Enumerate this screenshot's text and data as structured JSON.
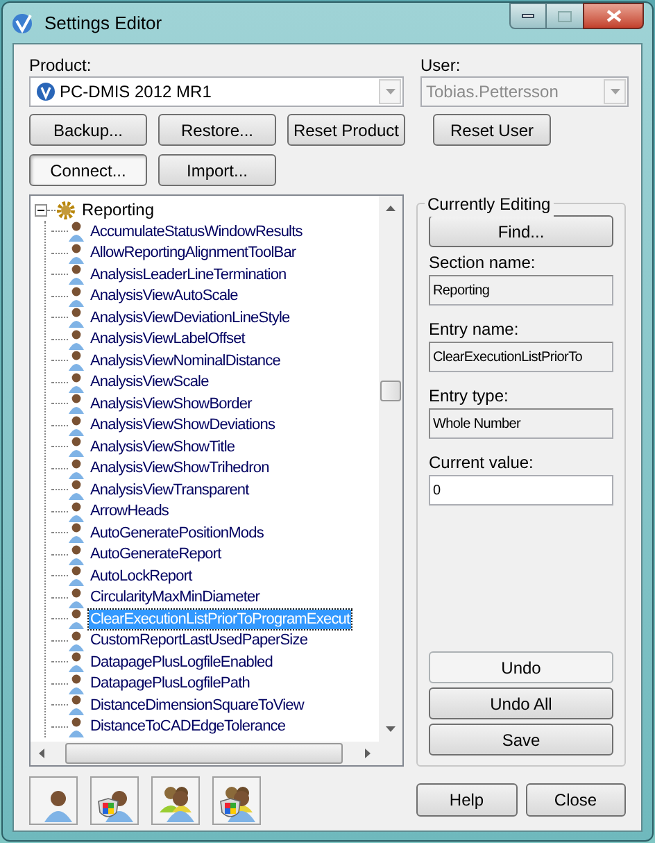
{
  "window": {
    "title": "Settings Editor"
  },
  "product": {
    "label": "Product:",
    "value": "PC-DMIS 2012 MR1",
    "disabled": false
  },
  "user": {
    "label": "User:",
    "value": "Tobias.Pettersson",
    "disabled": true
  },
  "buttons": [
    {
      "label": "Backup...",
      "pressed": false
    },
    {
      "label": "Restore...",
      "pressed": false
    },
    {
      "label": "Reset Product",
      "pressed": false
    },
    {
      "label": "Reset User",
      "pressed": false
    },
    {
      "label": "Connect...",
      "pressed": true
    },
    {
      "label": "Import...",
      "pressed": false
    }
  ],
  "tree": {
    "label": "Reporting",
    "expanded": true,
    "children": [
      {
        "label": "AccumulateStatusWindowResults",
        "selected": false
      },
      {
        "label": "AllowReportingAlignmentToolBar",
        "selected": false
      },
      {
        "label": "AnalysisLeaderLineTermination",
        "selected": false
      },
      {
        "label": "AnalysisViewAutoScale",
        "selected": false
      },
      {
        "label": "AnalysisViewDeviationLineStyle",
        "selected": false
      },
      {
        "label": "AnalysisViewLabelOffset",
        "selected": false
      },
      {
        "label": "AnalysisViewNominalDistance",
        "selected": false
      },
      {
        "label": "AnalysisViewScale",
        "selected": false
      },
      {
        "label": "AnalysisViewShowBorder",
        "selected": false
      },
      {
        "label": "AnalysisViewShowDeviations",
        "selected": false
      },
      {
        "label": "AnalysisViewShowTitle",
        "selected": false
      },
      {
        "label": "AnalysisViewShowTrihedron",
        "selected": false
      },
      {
        "label": "AnalysisViewTransparent",
        "selected": false
      },
      {
        "label": "ArrowHeads",
        "selected": false
      },
      {
        "label": "AutoGeneratePositionMods",
        "selected": false
      },
      {
        "label": "AutoGenerateReport",
        "selected": false
      },
      {
        "label": "AutoLockReport",
        "selected": false
      },
      {
        "label": "CircularityMaxMinDiameter",
        "selected": false
      },
      {
        "label": "ClearExecutionListPriorToProgramExecut",
        "selected": true
      },
      {
        "label": "CustomReportLastUsedPaperSize",
        "selected": false
      },
      {
        "label": "DatapagePlusLogfileEnabled",
        "selected": false
      },
      {
        "label": "DatapagePlusLogfilePath",
        "selected": false
      },
      {
        "label": "DistanceDimensionSquareToView",
        "selected": false
      },
      {
        "label": "DistanceToCADEdgeTolerance",
        "selected": false
      }
    ]
  },
  "user_buttons": [
    {
      "kind": "user"
    },
    {
      "kind": "admin-user"
    },
    {
      "kind": "group"
    },
    {
      "kind": "admin-group"
    }
  ],
  "editing": {
    "title": "Currently Editing",
    "find": "Find...",
    "fields": [
      {
        "label": "Section name:",
        "value": "Reporting",
        "editable": false
      },
      {
        "label": "Entry name:",
        "value": "ClearExecutionListPriorTo",
        "editable": false
      },
      {
        "label": "Entry type:",
        "value": "Whole Number",
        "editable": false
      },
      {
        "label": "Current value:",
        "value": "0",
        "editable": true
      }
    ],
    "actions": [
      {
        "label": "Undo",
        "disabled": true
      },
      {
        "label": "Undo All",
        "disabled": false
      },
      {
        "label": "Save",
        "disabled": false
      }
    ]
  },
  "footer_buttons": [
    "Help",
    "Close"
  ]
}
